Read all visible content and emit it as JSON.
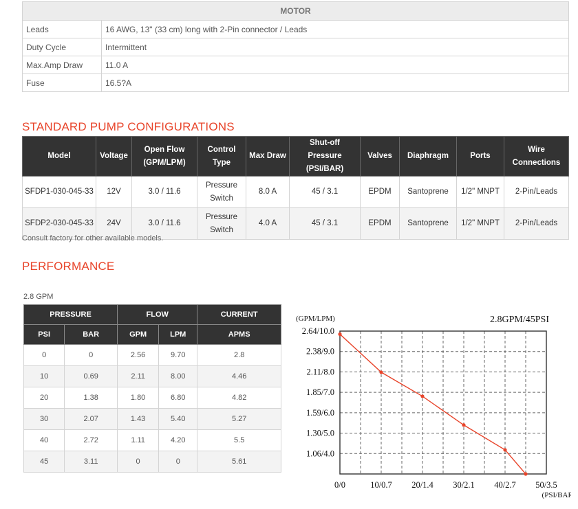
{
  "motor": {
    "title": "MOTOR",
    "rows": [
      {
        "label": "Leads",
        "value": "16 AWG, 13\" (33 cm) long with 2-Pin connector / Leads"
      },
      {
        "label": "Duty Cycle",
        "value": "Intermittent"
      },
      {
        "label": "Max.Amp Draw",
        "value": "11.0 A"
      },
      {
        "label": "Fuse",
        "value": "16.5?A"
      }
    ]
  },
  "configs": {
    "title": "STANDARD PUMP CONFIGURATIONS",
    "headers": {
      "model": "Model",
      "voltage": "Voltage",
      "flow_1": "Open Flow",
      "flow_2": "(GPM/LPM)",
      "control_1": "Control",
      "control_2": "Type",
      "draw": "Max Draw",
      "shutoff_1": "Shut-off Pressure",
      "shutoff_2": "(PSI/BAR)",
      "valves": "Valves",
      "diaphragm": "Diaphragm",
      "ports": "Ports",
      "wire": "Wire Connections"
    },
    "rows": [
      {
        "model": "SFDP1-030-045-33",
        "voltage": "12V",
        "flow": "3.0 / 11.6",
        "control_1": "Pressure",
        "control_2": "Switch",
        "draw": "8.0 A",
        "shutoff": "45 / 3.1",
        "valves": "EPDM",
        "diaphragm": "Santoprene",
        "ports": "1/2\" MNPT",
        "wire": "2-Pin/Leads"
      },
      {
        "model": "SFDP2-030-045-33",
        "voltage": "24V",
        "flow": "3.0 / 11.6",
        "control_1": "Pressure",
        "control_2": "Switch",
        "draw": "4.0 A",
        "shutoff": "45 / 3.1",
        "valves": "EPDM",
        "diaphragm": "Santoprene",
        "ports": "1/2\" MNPT",
        "wire": "2-Pin/Leads"
      }
    ],
    "note": "Consult factory for other available models."
  },
  "performance": {
    "title": "PERFORMANCE",
    "subtitle": "2.8 GPM",
    "groups": {
      "pressure": "PRESSURE",
      "flow": "FLOW",
      "current": "CURRENT"
    },
    "cols": {
      "psi": "PSI",
      "bar": "BAR",
      "gpm": "GPM",
      "lpm": "LPM",
      "amps": "APMS"
    },
    "rows": [
      {
        "psi": "0",
        "bar": "0",
        "gpm": "2.56",
        "lpm": "9.70",
        "amps": "2.8"
      },
      {
        "psi": "10",
        "bar": "0.69",
        "gpm": "2.11",
        "lpm": "8.00",
        "amps": "4.46"
      },
      {
        "psi": "20",
        "bar": "1.38",
        "gpm": "1.80",
        "lpm": "6.80",
        "amps": "4.82"
      },
      {
        "psi": "30",
        "bar": "2.07",
        "gpm": "1.43",
        "lpm": "5.40",
        "amps": "5.27"
      },
      {
        "psi": "40",
        "bar": "2.72",
        "gpm": "1.11",
        "lpm": "4.20",
        "amps": "5.5"
      },
      {
        "psi": "45",
        "bar": "3.11",
        "gpm": "0",
        "lpm": "0",
        "amps": "5.61"
      }
    ]
  },
  "chart_data": {
    "type": "line",
    "title": "2.8GPM/45PSI",
    "ylabel": "(GPM/LPM)",
    "xlabel": "(PSI/BAR)",
    "x_ticks": [
      "0/0",
      "10/0.7",
      "20/1.4",
      "30/2.1",
      "40/2.7",
      "50/3.5"
    ],
    "y_ticks": [
      "2.64/10.0",
      "2.38/9.0",
      "2.11/8.0",
      "1.85/7.0",
      "1.59/6.0",
      "1.30/5.0",
      "1.06/4.0"
    ],
    "xlim": [
      0,
      50
    ],
    "ylim": [
      0.8,
      2.64
    ],
    "grid": true,
    "line_color": "#e8442a",
    "series": [
      {
        "x": [
          0,
          10,
          20,
          30,
          40,
          45
        ],
        "y": [
          2.6,
          2.11,
          1.8,
          1.43,
          1.11,
          0.8
        ]
      }
    ]
  }
}
